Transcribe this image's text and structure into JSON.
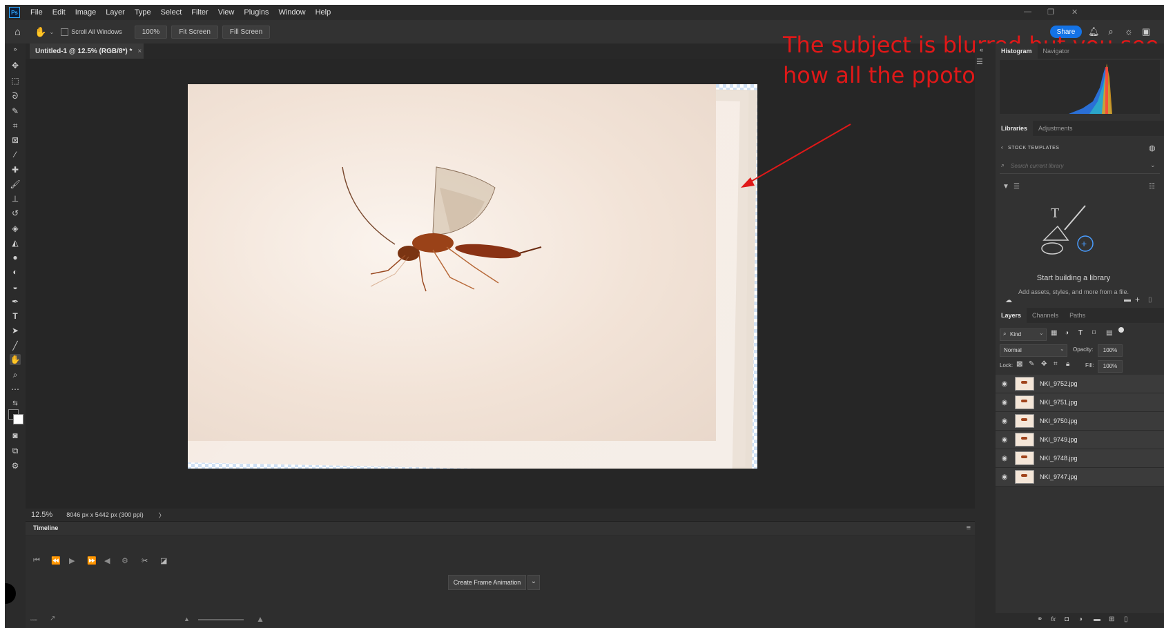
{
  "menu": {
    "logo": "Ps",
    "items": [
      "File",
      "Edit",
      "Image",
      "Layer",
      "Type",
      "Select",
      "Filter",
      "View",
      "Plugins",
      "Window",
      "Help"
    ]
  },
  "options": {
    "scroll_all": "Scroll All Windows",
    "zoom": "100%",
    "fit_screen": "Fit Screen",
    "fill_screen": "Fill Screen",
    "share": "Share"
  },
  "document": {
    "tab_title": "Untitled-1 @ 12.5% (RGB/8*) *",
    "tab_close": "×"
  },
  "status": {
    "zoom": "12.5%",
    "info": "8046 px x 5442 px (300 ppi)",
    "arrow": "〉"
  },
  "timeline": {
    "title": "Timeline",
    "create_button": "Create Frame Animation"
  },
  "panels": {
    "histogram_tabs": [
      "Histogram",
      "Navigator"
    ],
    "library_tabs": [
      "Libraries",
      "Adjustments"
    ],
    "stock_templates": "STOCK TEMPLATES",
    "search_placeholder": "Search current library",
    "empty_title": "Start building a library",
    "empty_desc": "Add assets, styles, and more from a file.",
    "layer_tabs": [
      "Layers",
      "Channels",
      "Paths"
    ],
    "kind": "Kind",
    "blend_mode": "Normal",
    "opacity_label": "Opacity:",
    "opacity_value": "100%",
    "lock_label": "Lock:",
    "fill_label": "Fill:",
    "fill_value": "100%"
  },
  "layers": [
    {
      "name": "NKI_9752.jpg"
    },
    {
      "name": "NKI_9751.jpg"
    },
    {
      "name": "NKI_9750.jpg"
    },
    {
      "name": "NKI_9749.jpg"
    },
    {
      "name": "NKI_9748.jpg"
    },
    {
      "name": "NKI_9747.jpg"
    }
  ],
  "annotation": {
    "text": "The subject is blurred but you see how all the ppotos have aligned",
    "color": "#e01818"
  },
  "colors": {
    "accent": "#1473e6",
    "panel_bg": "#323232"
  }
}
